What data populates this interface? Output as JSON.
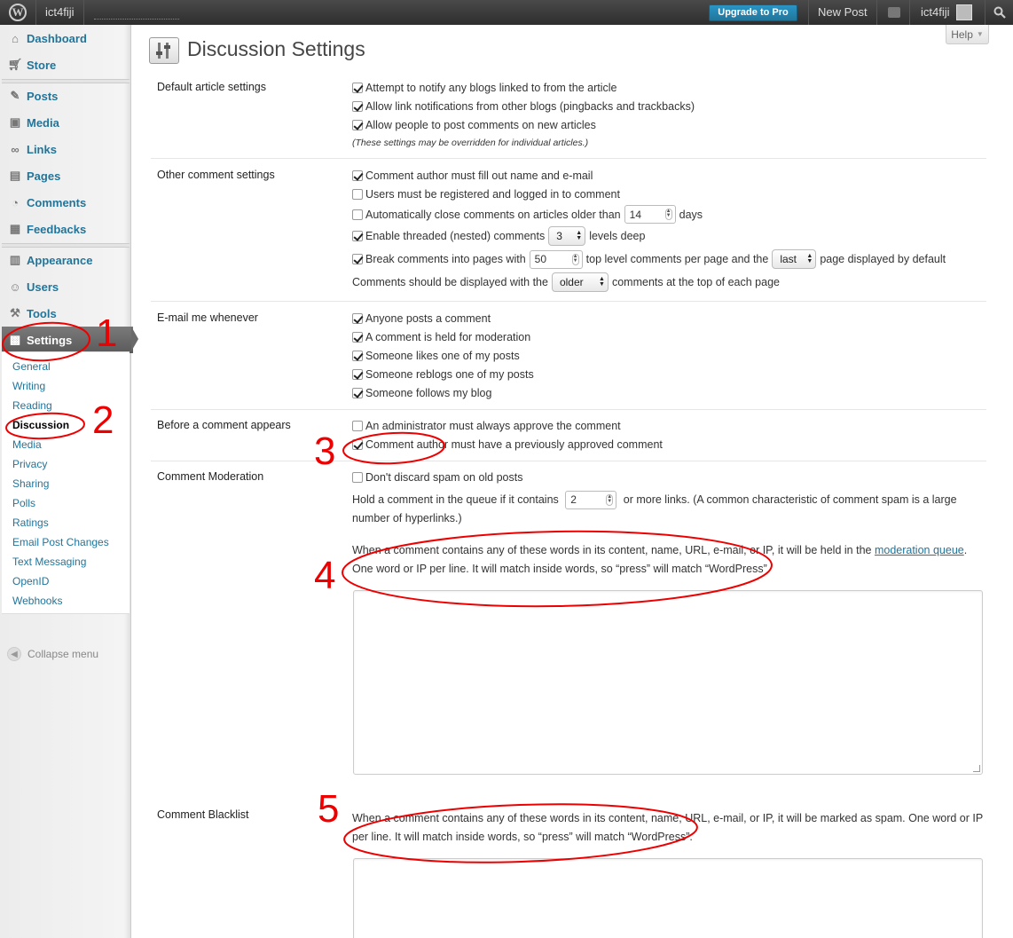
{
  "adminbar": {
    "site_name": "ict4fiji",
    "upgrade_label": "Upgrade to Pro",
    "new_post_label": "New Post",
    "user_name": "ict4fiji"
  },
  "help_label": "Help",
  "sidebar": {
    "items": [
      {
        "label": "Dashboard",
        "icon": "house-icon"
      },
      {
        "label": "Store",
        "icon": "cart-icon"
      },
      {
        "label": "Posts",
        "icon": "pin-icon"
      },
      {
        "label": "Media",
        "icon": "media-icon"
      },
      {
        "label": "Links",
        "icon": "link-icon"
      },
      {
        "label": "Pages",
        "icon": "page-icon"
      },
      {
        "label": "Comments",
        "icon": "comment-icon"
      },
      {
        "label": "Feedbacks",
        "icon": "feedback-icon"
      },
      {
        "label": "Appearance",
        "icon": "appearance-icon"
      },
      {
        "label": "Users",
        "icon": "users-icon"
      },
      {
        "label": "Tools",
        "icon": "tools-icon"
      },
      {
        "label": "Settings",
        "icon": "settings-icon"
      }
    ],
    "submenu": [
      "General",
      "Writing",
      "Reading",
      "Discussion",
      "Media",
      "Privacy",
      "Sharing",
      "Polls",
      "Ratings",
      "Email Post Changes",
      "Text Messaging",
      "OpenID",
      "Webhooks"
    ],
    "collapse_label": "Collapse menu"
  },
  "page_title": "Discussion Settings",
  "sections": {
    "default_article": {
      "label": "Default article settings",
      "options": [
        {
          "label": "Attempt to notify any blogs linked to from the article",
          "checked": true
        },
        {
          "label": "Allow link notifications from other blogs (pingbacks and trackbacks)",
          "checked": true
        },
        {
          "label": "Allow people to post comments on new articles",
          "checked": true
        }
      ],
      "note": "(These settings may be overridden for individual articles.)"
    },
    "other_comment": {
      "label": "Other comment settings",
      "opt1": "Comment author must fill out name and e-mail",
      "opt2": "Users must be registered and logged in to comment",
      "opt3_pre": "Automatically close comments on articles older than",
      "opt3_value": "14",
      "opt3_post": "days",
      "opt4_pre": "Enable threaded (nested) comments",
      "opt4_value": "3",
      "opt4_post": "levels deep",
      "opt5_pre": "Break comments into pages with",
      "opt5_value": "50",
      "opt5_mid": "top level comments per page and the",
      "opt5_select": "last",
      "opt5_post": "page displayed by default",
      "opt6_pre": "Comments should be displayed with the",
      "opt6_select": "older",
      "opt6_post": "comments at the top of each page"
    },
    "email_me": {
      "label": "E-mail me whenever",
      "options": [
        {
          "label": "Anyone posts a comment",
          "checked": true
        },
        {
          "label": "A comment is held for moderation",
          "checked": true
        },
        {
          "label": "Someone likes one of my posts",
          "checked": true
        },
        {
          "label": "Someone reblogs one of my posts",
          "checked": true
        },
        {
          "label": "Someone follows my blog",
          "checked": true
        }
      ]
    },
    "before_comment": {
      "label": "Before a comment appears",
      "options": [
        {
          "label": "An administrator must always approve the comment",
          "checked": false
        },
        {
          "label": "Comment author must have a previously approved comment",
          "checked": true
        }
      ]
    },
    "moderation": {
      "label": "Comment Moderation",
      "spam_option": "Don't discard spam on old posts",
      "hold_pre": "Hold a comment in the queue if it contains",
      "hold_value": "2",
      "hold_post": "or more links. (A common characteristic of comment spam is a large number of hyperlinks.)",
      "words_pre": "When a comment contains any of these words in its content, name, URL, e-mail, or IP, it will be held in the",
      "words_link": "moderation queue",
      "words_post": ". One word or IP per line. It will match inside words, so “press” will match “WordPress”."
    },
    "blacklist": {
      "label": "Comment Blacklist",
      "text": "When a comment contains any of these words in its content, name, URL, e-mail, or IP, it will be marked as spam. One word or IP per line. It will match inside words, so “press” will match “WordPress”."
    }
  },
  "annotations": [
    "1",
    "2",
    "3",
    "4",
    "5"
  ],
  "colors": {
    "link": "#21759b",
    "annotation": "#e00000",
    "adminbar": "#464646",
    "upgrade_button": "#21759b"
  }
}
